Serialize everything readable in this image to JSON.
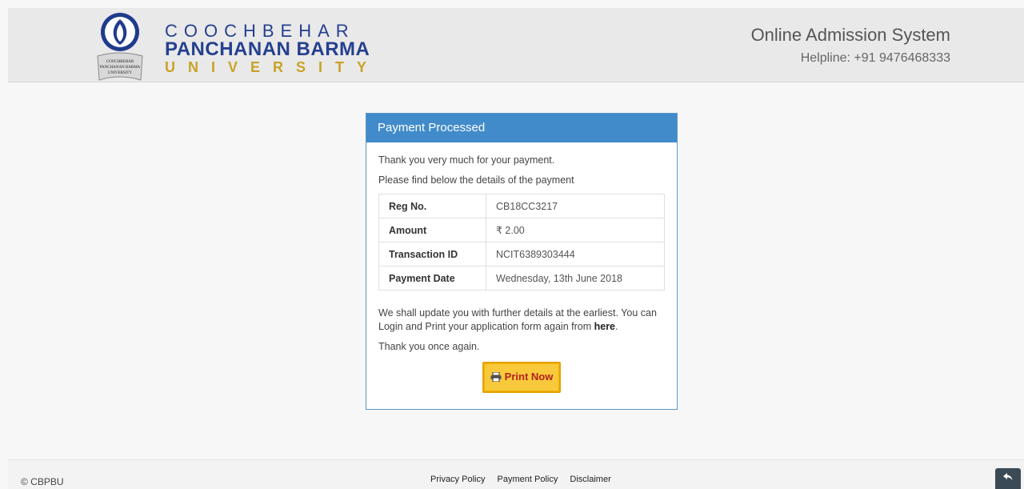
{
  "header": {
    "logo": {
      "line1": "COOCHBEHAR",
      "line2": "PANCHANAN BARMA",
      "line3": "UNIVERSITY",
      "seal_text": [
        "COOCHBEHAR",
        "PANCHANAN BARMA",
        "UNIVERSITY"
      ],
      "icon": "university-logo-icon"
    },
    "title": "Online Admission System",
    "helpline": "Helpline: +91 9476468333"
  },
  "card": {
    "title": "Payment Processed",
    "thank_line": "Thank you very much for your payment.",
    "details_line": "Please find below the details of the payment",
    "rows": [
      {
        "label": "Reg No.",
        "value": "CB18CC3217"
      },
      {
        "label": "Amount",
        "value": "₹ 2.00"
      },
      {
        "label": "Transaction ID",
        "value": "NCIT6389303444"
      },
      {
        "label": "Payment Date",
        "value": "Wednesday, 13th June 2018"
      }
    ],
    "update_text": "We shall update you with further details at the earliest. You can Login and Print your application form again from",
    "here_link": "here",
    "period": ".",
    "thanks_again": "Thank you once again.",
    "print_button": "Print Now",
    "print_icon": "printer-icon"
  },
  "footer": {
    "copyright": "© CBPBU",
    "links": [
      "Privacy Policy",
      "Payment Policy",
      "Disclaimer"
    ],
    "back_icon": "reply-arrow-icon"
  },
  "colors": {
    "primary": "#428bca",
    "brand_blue": "#25408f",
    "brand_gold": "#c9a227",
    "button": "#f8c93b",
    "button_text": "#b22222"
  }
}
